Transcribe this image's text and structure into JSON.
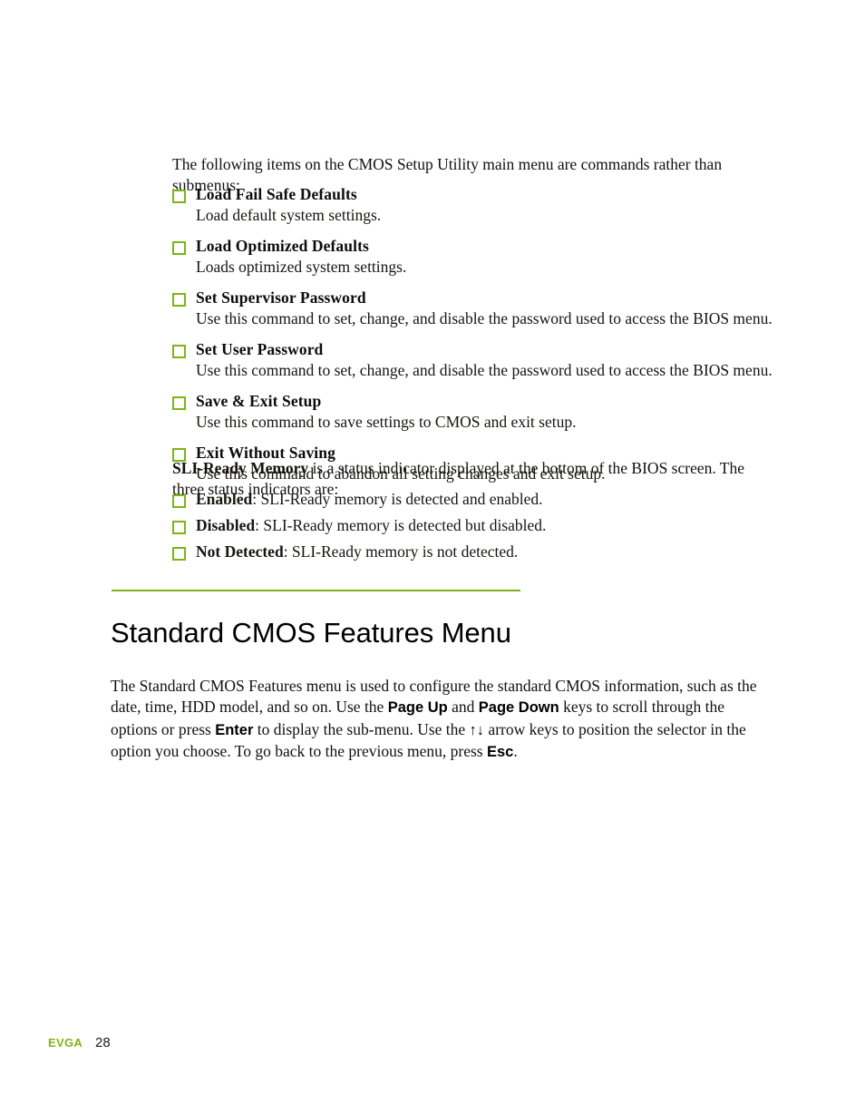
{
  "page": {
    "background_color": "#ffffff",
    "accent_color": "#7db518",
    "text_color": "#121110"
  },
  "intro": {
    "paragraph": "The following items on the CMOS Setup Utility main menu are commands rather than submenus:"
  },
  "commands": {
    "bullet_icon": "green-square-checkbox-icon",
    "items": [
      {
        "title": "Load Fail Safe Defaults",
        "description": "Load default system settings."
      },
      {
        "title": "Load Optimized Defaults",
        "description": "Loads optimized system settings."
      },
      {
        "title": "Set Supervisor Password",
        "description": "Use this command to set, change, and disable the password used to access the BIOS menu."
      },
      {
        "title": "Set User Password",
        "description": "Use this command to set, change, and disable the password used to access the BIOS menu."
      },
      {
        "title": "Save & Exit Setup",
        "description": "Use this command to save settings to CMOS and exit setup."
      },
      {
        "title": "Exit Without Saving",
        "description": "Use this command to abandon all setting changes and exit setup."
      }
    ]
  },
  "sli_paragraph": {
    "lead_bold": "SLI-Ready Memory",
    "rest": " is a status indicator displayed at the bottom of the BIOS screen. The three status indicators are:"
  },
  "status_indicators": {
    "bullet_icon": "green-square-checkbox-icon",
    "items": [
      {
        "label": "Enabled",
        "description": ": SLI-Ready memory is detected and enabled."
      },
      {
        "label": "Disabled",
        "description": ": SLI-Ready memory is detected but disabled."
      },
      {
        "label": "Not Detected",
        "description": ": SLI-Ready memory is not detected."
      }
    ]
  },
  "section": {
    "heading": "Standard CMOS Features Menu",
    "paragraph": {
      "part1": "The Standard CMOS Features menu is used to configure the standard CMOS information, such as the date, time, HDD model, and so on. Use the ",
      "key1": "Page Up",
      "part2": " and ",
      "key2": "Page Down",
      "part3": " keys to scroll through the options or press ",
      "key3": "Enter",
      "part4": " to display the sub-menu. Use the ",
      "arrows": "↑↓",
      "part5": " arrow keys to position the selector in the option you choose. To go back to the previous menu, press ",
      "key4": "Esc",
      "part6": "."
    }
  },
  "footer": {
    "brand": "EVGA",
    "page_number": "28"
  }
}
